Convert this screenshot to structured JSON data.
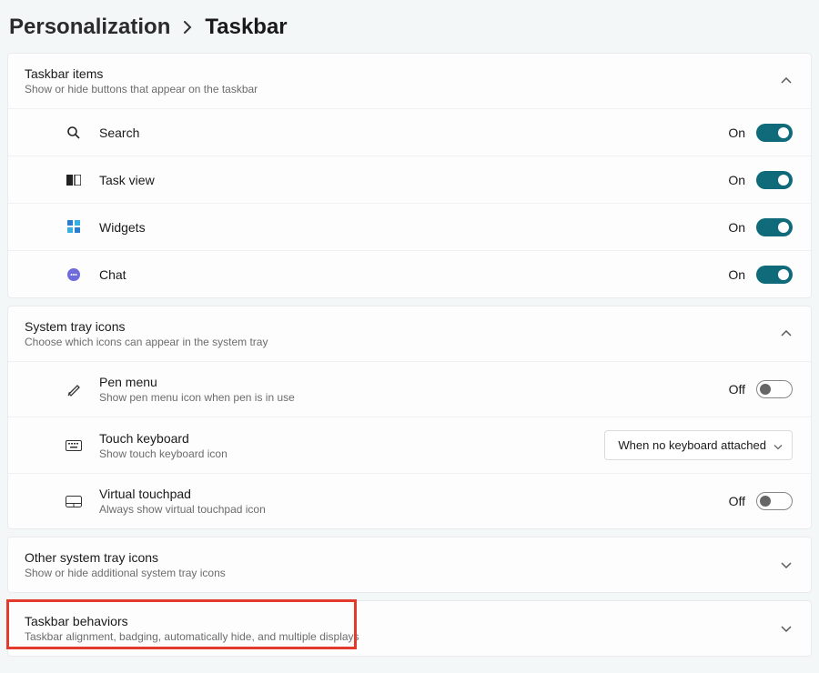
{
  "breadcrumb": {
    "parent": "Personalization",
    "current": "Taskbar"
  },
  "sections": {
    "taskbarItems": {
      "title": "Taskbar items",
      "sub": "Show or hide buttons that appear on the taskbar",
      "rows": [
        {
          "title": "Search",
          "state": "On",
          "on": true
        },
        {
          "title": "Task view",
          "state": "On",
          "on": true
        },
        {
          "title": "Widgets",
          "state": "On",
          "on": true
        },
        {
          "title": "Chat",
          "state": "On",
          "on": true
        }
      ]
    },
    "systemTray": {
      "title": "System tray icons",
      "sub": "Choose which icons can appear in the system tray",
      "rows": [
        {
          "title": "Pen menu",
          "sub": "Show pen menu icon when pen is in use",
          "state": "Off",
          "on": false
        },
        {
          "title": "Touch keyboard",
          "sub": "Show touch keyboard icon",
          "select": "When no keyboard attached"
        },
        {
          "title": "Virtual touchpad",
          "sub": "Always show virtual touchpad icon",
          "state": "Off",
          "on": false
        }
      ]
    },
    "otherTray": {
      "title": "Other system tray icons",
      "sub": "Show or hide additional system tray icons"
    },
    "behaviors": {
      "title": "Taskbar behaviors",
      "sub": "Taskbar alignment, badging, automatically hide, and multiple displays"
    }
  }
}
